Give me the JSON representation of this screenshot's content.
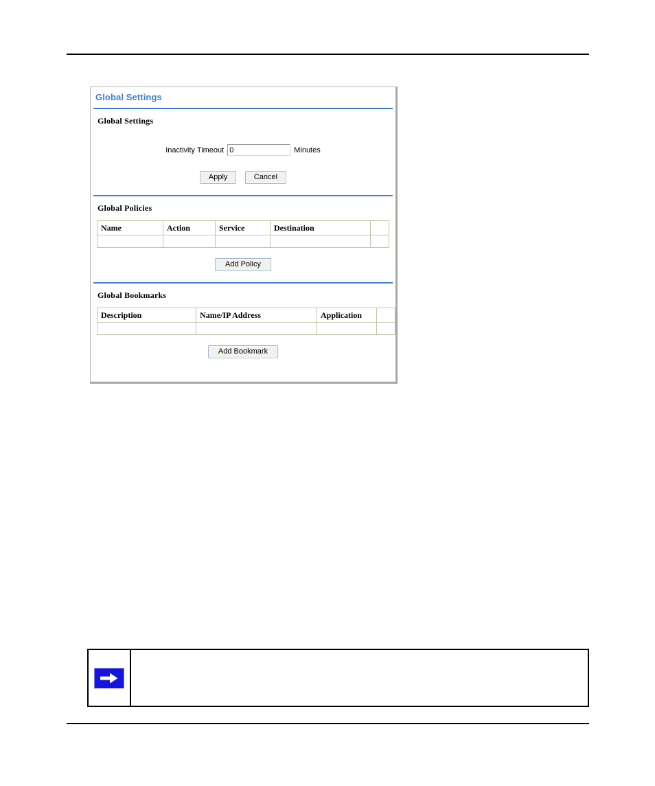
{
  "page": {
    "top_rule": "",
    "bottom_rule": ""
  },
  "panel": {
    "title": "Global Settings",
    "sections": {
      "settings": {
        "heading": "Global Settings",
        "field_label": "Inactivity Timeout",
        "field_value": "0",
        "field_placeholder": "",
        "unit_label": "Minutes",
        "apply_label": "Apply",
        "cancel_label": "Cancel"
      },
      "policies": {
        "heading": "Global Policies",
        "columns": [
          "Name",
          "Action",
          "Service",
          "Destination",
          ""
        ],
        "rows": [
          [
            "",
            "",
            "",
            "",
            ""
          ]
        ],
        "add_button_label": "Add Policy"
      },
      "bookmarks": {
        "heading": "Global Bookmarks",
        "columns": [
          "Description",
          "Name/IP Address",
          "Application",
          ""
        ],
        "rows": [
          [
            "",
            "",
            "",
            ""
          ]
        ],
        "add_button_label": "Add Bookmark"
      }
    }
  },
  "note": {
    "icon": "blue-arrow-note-icon",
    "text": ""
  },
  "colors": {
    "panel_title_blue": "#3c7fd0",
    "divider_blue": "#3d7fd3",
    "note_icon_blue": "#1414e0",
    "table_border": "#c3c3a8",
    "panel_border": "#a8a8a0"
  }
}
